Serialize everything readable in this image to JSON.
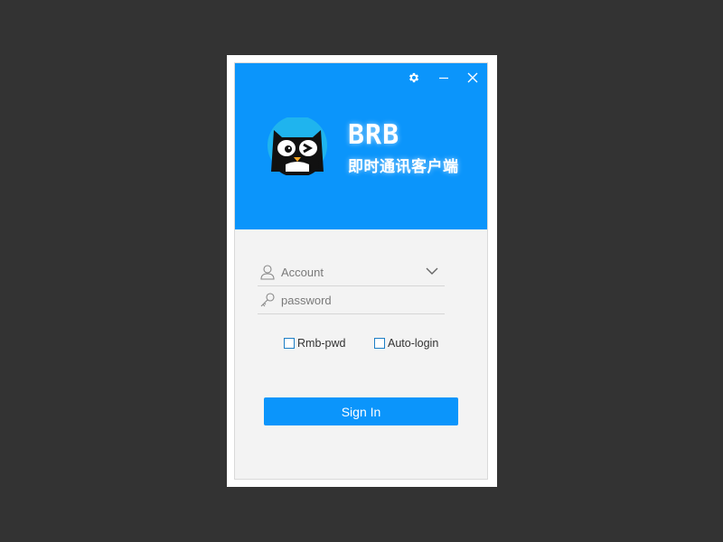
{
  "window": {
    "controls": {
      "settings_icon": "gear-icon",
      "minimize_icon": "minimize-icon",
      "close_icon": "close-icon"
    }
  },
  "brand": {
    "name": "BRB",
    "subtitle": "即时通讯客户端",
    "logo_icon": "owl-logo"
  },
  "form": {
    "account": {
      "placeholder": "Account",
      "value": "",
      "icon": "user-icon",
      "dropdown_icon": "chevron-down-icon"
    },
    "password": {
      "placeholder": "password",
      "value": "",
      "icon": "key-icon"
    },
    "remember_label": "Rmb-pwd",
    "autologin_label": "Auto-login",
    "signin_label": "Sign In"
  },
  "colors": {
    "primary": "#0b95fb",
    "background": "#f3f3f3",
    "page_background": "#333333",
    "checkbox_border": "#1d7fc6"
  }
}
